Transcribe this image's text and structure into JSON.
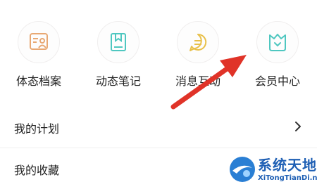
{
  "icons": [
    {
      "label": "体态档案",
      "icon": "profile-card-icon",
      "color": "#e8a873"
    },
    {
      "label": "动态笔记",
      "icon": "bookmark-book-icon",
      "color": "#4fc7c0"
    },
    {
      "label": "消息互动",
      "icon": "chat-bubble-icon",
      "color": "#e8c04a"
    },
    {
      "label": "会员中心",
      "icon": "crown-shield-icon",
      "color": "#4fc7c0"
    }
  ],
  "list": [
    {
      "label": "我的计划",
      "icon": "chevron-right-icon"
    },
    {
      "label": "我的收藏"
    }
  ],
  "annotation": {
    "icon": "red-arrow",
    "color": "#e03328"
  },
  "watermark": {
    "title": "系统天地",
    "url": "XiTongTianDi.net",
    "color": "#1e5fb4"
  }
}
